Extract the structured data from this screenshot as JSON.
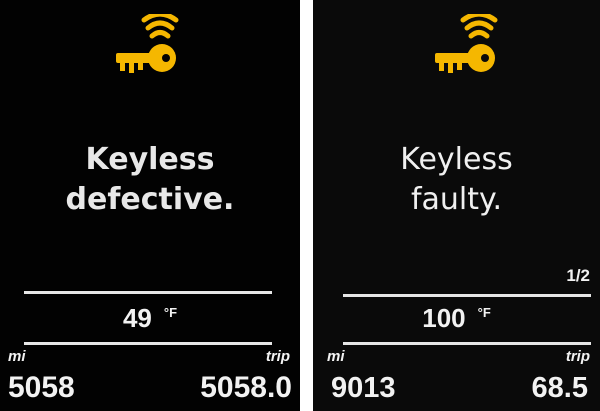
{
  "colors": {
    "warning_amber": "#f5b700",
    "text": "#f2f2f2",
    "background": "#000000"
  },
  "panels": [
    {
      "icon": "keyless-warning-icon",
      "message": {
        "line1": "Keyless",
        "line2": "defective."
      },
      "page_indicator": "",
      "temperature": {
        "value": "49",
        "unit": "°F"
      },
      "odometer": {
        "mi_label": "mi",
        "trip_label": "trip",
        "total": "5058",
        "trip": "5058.0"
      }
    },
    {
      "icon": "keyless-warning-icon",
      "message": {
        "line1": "Keyless",
        "line2": "faulty."
      },
      "page_indicator": "1/2",
      "temperature": {
        "value": "100",
        "unit": "°F"
      },
      "odometer": {
        "mi_label": "mi",
        "trip_label": "trip",
        "total": "9013",
        "trip": "68.5"
      }
    }
  ]
}
